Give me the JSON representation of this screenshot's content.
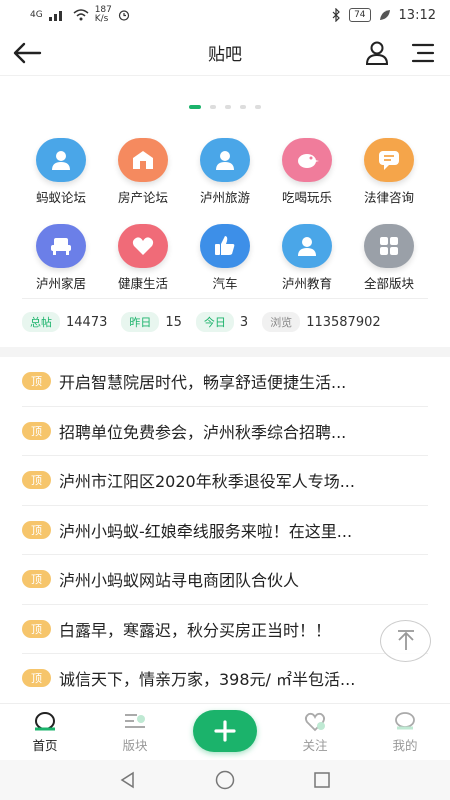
{
  "status": {
    "network": "4G",
    "speed_value": "187",
    "speed_unit": "K/s",
    "battery": "74",
    "time": "13:12"
  },
  "header": {
    "title": "贴吧"
  },
  "carousel": {
    "count": 5,
    "active": 0
  },
  "categories": [
    {
      "label": "蚂蚁论坛",
      "color": "#4aa6e8",
      "icon": "person-icon"
    },
    {
      "label": "房产论坛",
      "color": "#f58a5f",
      "icon": "house-icon"
    },
    {
      "label": "泸州旅游",
      "color": "#4aa6e8",
      "icon": "person-icon"
    },
    {
      "label": "吃喝玩乐",
      "color": "#f07c9b",
      "icon": "bird-icon"
    },
    {
      "label": "法律咨询",
      "color": "#f5a54a",
      "icon": "chat-icon"
    },
    {
      "label": "泸州家居",
      "color": "#6b7fe8",
      "icon": "sofa-icon"
    },
    {
      "label": "健康生活",
      "color": "#f06b78",
      "icon": "heart-icon"
    },
    {
      "label": "汽车",
      "color": "#3d8fe8",
      "icon": "thumb-icon"
    },
    {
      "label": "泸州教育",
      "color": "#4aa6e8",
      "icon": "person-icon"
    },
    {
      "label": "全部版块",
      "color": "#9aa0a8",
      "icon": "grid-icon"
    }
  ],
  "stats": [
    {
      "label": "总帖",
      "value": "14473"
    },
    {
      "label": "昨日",
      "value": "15"
    },
    {
      "label": "今日",
      "value": "3"
    },
    {
      "label": "浏览",
      "value": "113587902"
    }
  ],
  "posts": {
    "badge": "顶",
    "items": [
      "开启智慧院居时代，畅享舒适便捷生活...",
      "招聘单位免费参会，泸州秋季综合招聘...",
      "泸州市江阳区2020年秋季退役军人专场...",
      "泸州小蚂蚁-红娘牵线服务来啦！在这里...",
      "泸州小蚂蚁网站寻电商团队合伙人",
      "白露早，寒露迟，秋分买房正当时！！",
      "诚信天下，情亲万家，398元/ ㎡半包活..."
    ]
  },
  "tabs": [
    {
      "label": "首页",
      "active": true
    },
    {
      "label": "版块",
      "active": false
    },
    {
      "label": "关注",
      "active": false
    },
    {
      "label": "我的",
      "active": false
    }
  ],
  "colors": {
    "accent": "#1bb36b",
    "badge": "#f6c56b"
  }
}
